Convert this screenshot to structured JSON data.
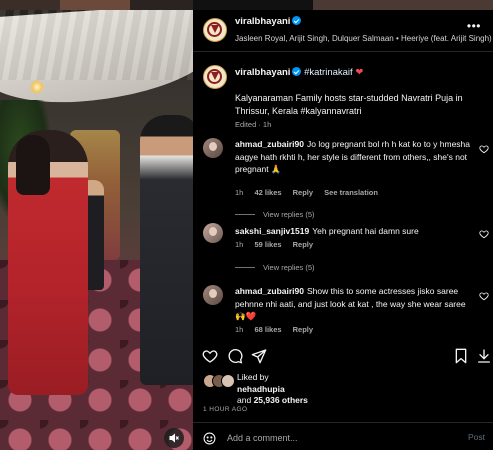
{
  "post": {
    "username": "viralbhayani",
    "audio": "Jasleen Royal, Arijit Singh, Dulquer Salmaan • Heeriye (feat. Arijit Singh)",
    "more": "•••"
  },
  "caption": {
    "username": "viralbhayani",
    "hashtag": "#katrinakaif",
    "heart": "❤",
    "text": "Kalyanaraman Family hosts star-studded Navratri Puja in Thrissur, Kerala #kalyannavratri",
    "edited": "Edited · 1h"
  },
  "comments": [
    {
      "username": "ahmad_zubairi90",
      "text": "Jo log pregnant bol rh h kat ko to y hmesha aagye hath rkhti h, her style is different from others,, she's not pregnant 🙏",
      "time": "1h",
      "likes": "42 likes",
      "reply": "Reply",
      "translate": "See translation",
      "view_replies": "View replies (5)"
    },
    {
      "username": "sakshi_sanjiv1519",
      "text": "Yeh pregnant hai damn sure",
      "time": "1h",
      "likes": "59 likes",
      "reply": "Reply",
      "view_replies": "View replies (5)"
    },
    {
      "username": "ahmad_zubairi90",
      "text": "Show this to some actresses jisko saree pehnne nhi aati, and just look at kat , the way she wear saree 🙌❤️",
      "time": "1h",
      "likes": "68 likes",
      "reply": "Reply"
    }
  ],
  "likes": {
    "liked_by": "Liked by",
    "user": "nehadhupia",
    "and": "and",
    "others": "25,936 others"
  },
  "time_ago": "1 HOUR AGO",
  "add_comment": {
    "placeholder": "Add a comment...",
    "post_label": "Post"
  },
  "colors": {
    "verified": "#0095f6",
    "heart": "#ed4956",
    "muted_text": "#a8a8a8",
    "post_disabled": "#5c6c7f"
  }
}
